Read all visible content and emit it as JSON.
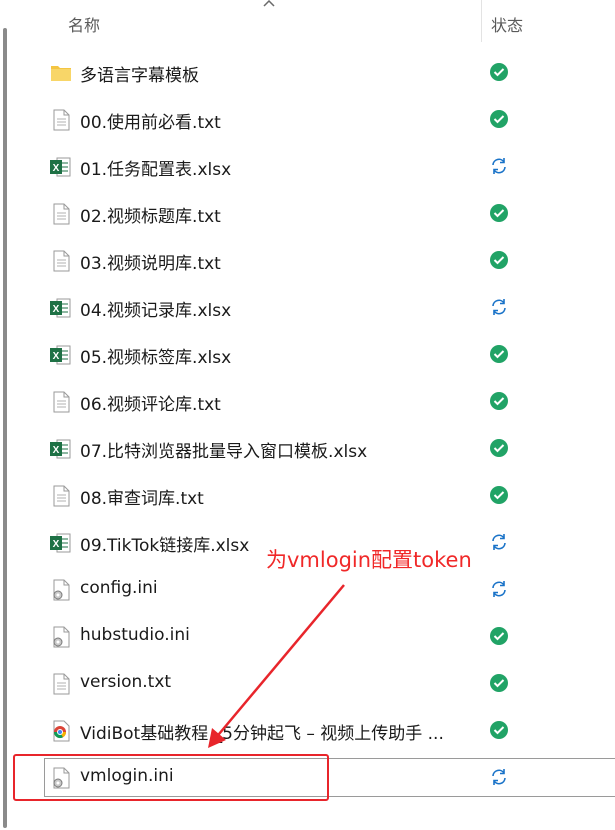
{
  "header": {
    "name_label": "名称",
    "status_label": "状态"
  },
  "files": [
    {
      "name": "多语言字幕模板",
      "type": "folder",
      "status": "synced"
    },
    {
      "name": "00.使用前必看.txt",
      "type": "text",
      "status": "synced"
    },
    {
      "name": "01.任务配置表.xlsx",
      "type": "excel",
      "status": "syncing"
    },
    {
      "name": "02.视频标题库.txt",
      "type": "text",
      "status": "synced"
    },
    {
      "name": "03.视频说明库.txt",
      "type": "text",
      "status": "synced"
    },
    {
      "name": "04.视频记录库.xlsx",
      "type": "excel",
      "status": "syncing"
    },
    {
      "name": "05.视频标签库.xlsx",
      "type": "excel",
      "status": "synced"
    },
    {
      "name": "06.视频评论库.txt",
      "type": "text",
      "status": "synced"
    },
    {
      "name": "07.比特浏览器批量导入窗口模板.xlsx",
      "type": "excel",
      "status": "synced"
    },
    {
      "name": "08.审查词库.txt",
      "type": "text",
      "status": "synced"
    },
    {
      "name": "09.TikTok链接库.xlsx",
      "type": "excel",
      "status": "syncing"
    },
    {
      "name": "config.ini",
      "type": "ini",
      "status": "syncing"
    },
    {
      "name": "hubstudio.ini",
      "type": "ini",
      "status": "synced"
    },
    {
      "name": "version.txt",
      "type": "text",
      "status": "synced"
    },
    {
      "name": "VidiBot基础教程 _5分钟起飞 – 视频上传助手 ...",
      "type": "chrome",
      "status": "synced"
    },
    {
      "name": "vmlogin.ini",
      "type": "ini",
      "status": "syncing",
      "selected": true
    }
  ],
  "annotation": {
    "text": "为vmlogin配置token",
    "color": "#f02828"
  },
  "colors": {
    "synced": "#21a366",
    "syncing": "#1a73c8",
    "excel": "#1e7145",
    "folder": "#f4c542"
  }
}
